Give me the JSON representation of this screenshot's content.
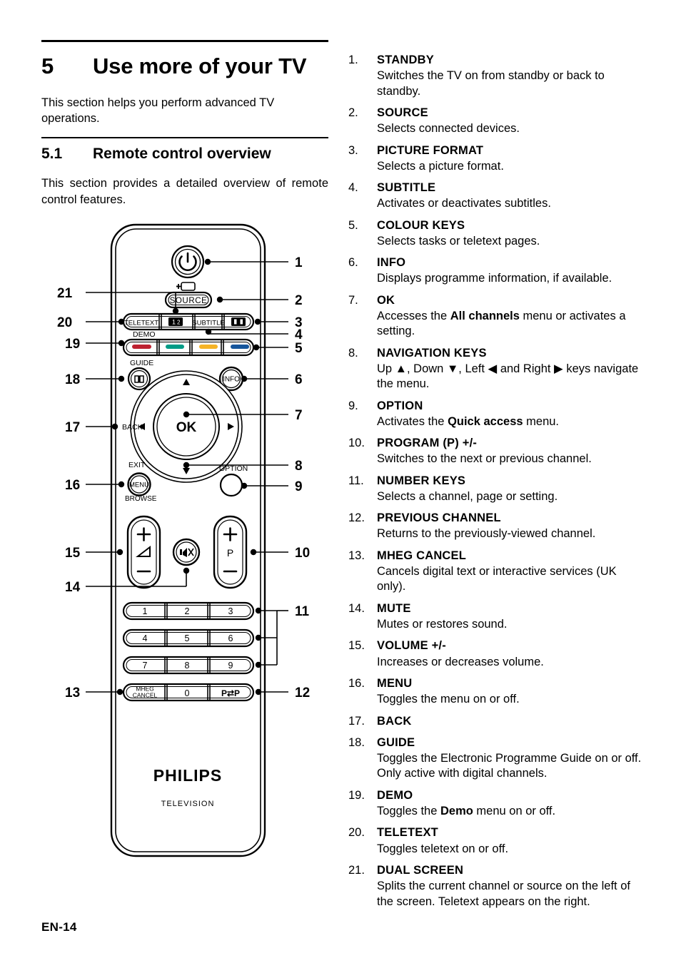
{
  "page": {
    "chapter_number": "5",
    "chapter_title": "Use more of your TV",
    "intro": "This section helps you perform advanced TV operations.",
    "section_number": "5.1",
    "section_title": "Remote control overview",
    "section_intro": "This section provides a detailed overview of remote control features.",
    "footer": "EN-14"
  },
  "remote": {
    "brand": "PHILIPS",
    "sub_brand": "TELEVISION",
    "buttons": {
      "power": "power-icon",
      "source_icon": "source-input-icon",
      "source": "SOURCE",
      "teletext": "TELETEXT",
      "dual_screen": "dual-screen-icon",
      "subtitle": "SUBTITLE",
      "picture_format": "picture-format-icon",
      "demo": "DEMO",
      "colour_red": "red-key",
      "colour_green": "green-key",
      "colour_yellow": "yellow-key",
      "colour_blue": "blue-key",
      "guide": "GUIDE",
      "guide_icon": "book-icon",
      "info": "INFO",
      "back": "BACK",
      "ok": "OK",
      "up": "▲",
      "down": "▼",
      "left": "◀",
      "right": "▶",
      "exit": "EXIT",
      "menu": "MENU",
      "browse": "BROWSE",
      "option": "OPTION",
      "volume_plus": "+",
      "volume_icon": "volume-icon",
      "volume_minus": "–",
      "mute": "mute-icon",
      "program_plus": "+",
      "program_label": "P",
      "program_minus": "–",
      "mheg_cancel_line1": "MHEG",
      "mheg_cancel_line2": "CANCEL",
      "zero": "0",
      "previous_channel": "P⇆P"
    },
    "numeric_keys": [
      "1",
      "2",
      "3",
      "4",
      "5",
      "6",
      "7",
      "8",
      "9"
    ],
    "callouts_left": [
      "21",
      "20",
      "19",
      "18",
      "17",
      "16",
      "15",
      "14",
      "13"
    ],
    "callouts_right": [
      "1",
      "2",
      "3",
      "4",
      "5",
      "6",
      "7",
      "8",
      "9",
      "10",
      "11",
      "12"
    ],
    "colors": {
      "red": "#bd2130",
      "green": "#009b86",
      "yellow": "#f5b326",
      "blue": "#15559c"
    }
  },
  "legend": [
    {
      "index": "1.",
      "title": "STANDBY",
      "desc_html": "Switches the TV on from standby or back to standby."
    },
    {
      "index": "2.",
      "title": "SOURCE",
      "desc_html": "Selects connected devices."
    },
    {
      "index": "3.",
      "title": "PICTURE FORMAT",
      "desc_html": "Selects a picture format."
    },
    {
      "index": "4.",
      "title": "SUBTITLE",
      "desc_html": "Activates or deactivates subtitles."
    },
    {
      "index": "5.",
      "title": "COLOUR KEYS",
      "desc_html": "Selects tasks or teletext pages."
    },
    {
      "index": "6.",
      "title": "INFO",
      "desc_html": "Displays programme information, if available."
    },
    {
      "index": "7.",
      "title": "OK",
      "desc_html": "Accesses the <b>All channels</b> menu or activates a setting."
    },
    {
      "index": "8.",
      "title": "NAVIGATION KEYS",
      "desc_html": "Up ▲, Down ▼, Left ◀ and Right ▶ keys navigate the menu."
    },
    {
      "index": "9.",
      "title": "OPTION",
      "desc_html": "Activates the <b>Quick access</b> menu."
    },
    {
      "index": "10.",
      "title": "PROGRAM (P) +/-",
      "desc_html": "Switches to the next or previous channel."
    },
    {
      "index": "11.",
      "title": "NUMBER KEYS",
      "desc_html": "Selects a channel, page or setting."
    },
    {
      "index": "12.",
      "title": "PREVIOUS CHANNEL",
      "desc_html": "Returns to the previously-viewed channel."
    },
    {
      "index": "13.",
      "title": "MHEG CANCEL",
      "desc_html": "Cancels digital text or interactive services (UK only)."
    },
    {
      "index": "14.",
      "title": "MUTE",
      "desc_html": "Mutes or restores sound."
    },
    {
      "index": "15.",
      "title": "VOLUME +/-",
      "desc_html": "Increases or decreases volume."
    },
    {
      "index": "16.",
      "title": "MENU",
      "desc_html": "Toggles the menu on or off."
    },
    {
      "index": "17.",
      "title": "BACK",
      "desc_html": ""
    },
    {
      "index": "18.",
      "title": "GUIDE",
      "desc_html": "Toggles the Electronic Programme Guide on or off. Only active with digital channels."
    },
    {
      "index": "19.",
      "title": "DEMO",
      "desc_html": "Toggles the <b>Demo</b> menu on or off."
    },
    {
      "index": "20.",
      "title": "TELETEXT",
      "desc_html": "Toggles teletext on or off."
    },
    {
      "index": "21.",
      "title": "DUAL SCREEN",
      "desc_html": "Splits the current channel or source on the left of the screen. Teletext appears on the right."
    }
  ]
}
